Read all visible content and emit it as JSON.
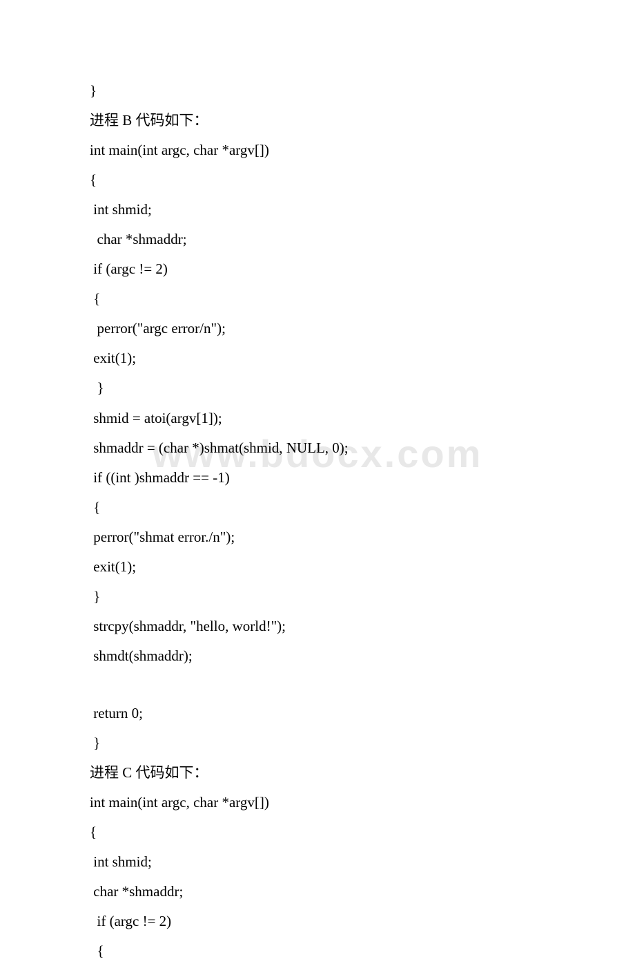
{
  "watermark": "www.bdocx.com",
  "lines": [
    "}",
    "进程 B 代码如下：",
    "int main(int argc, char *argv[])",
    "{",
    " int shmid;",
    "  char *shmaddr;",
    " if (argc != 2)",
    " {",
    "  perror(\"argc error/n\");",
    " exit(1);",
    "  }",
    " shmid = atoi(argv[1]);",
    " shmaddr = (char *)shmat(shmid, NULL, 0);",
    " if ((int )shmaddr == -1)",
    " {",
    " perror(\"shmat error./n\");",
    " exit(1);",
    " }",
    " strcpy(shmaddr, \"hello, world!\");",
    " shmdt(shmaddr);",
    "",
    " return 0;",
    " }",
    "进程 C 代码如下：",
    "int main(int argc, char *argv[])",
    "{",
    " int shmid;",
    " char *shmaddr;",
    "  if (argc != 2)",
    "  {"
  ]
}
